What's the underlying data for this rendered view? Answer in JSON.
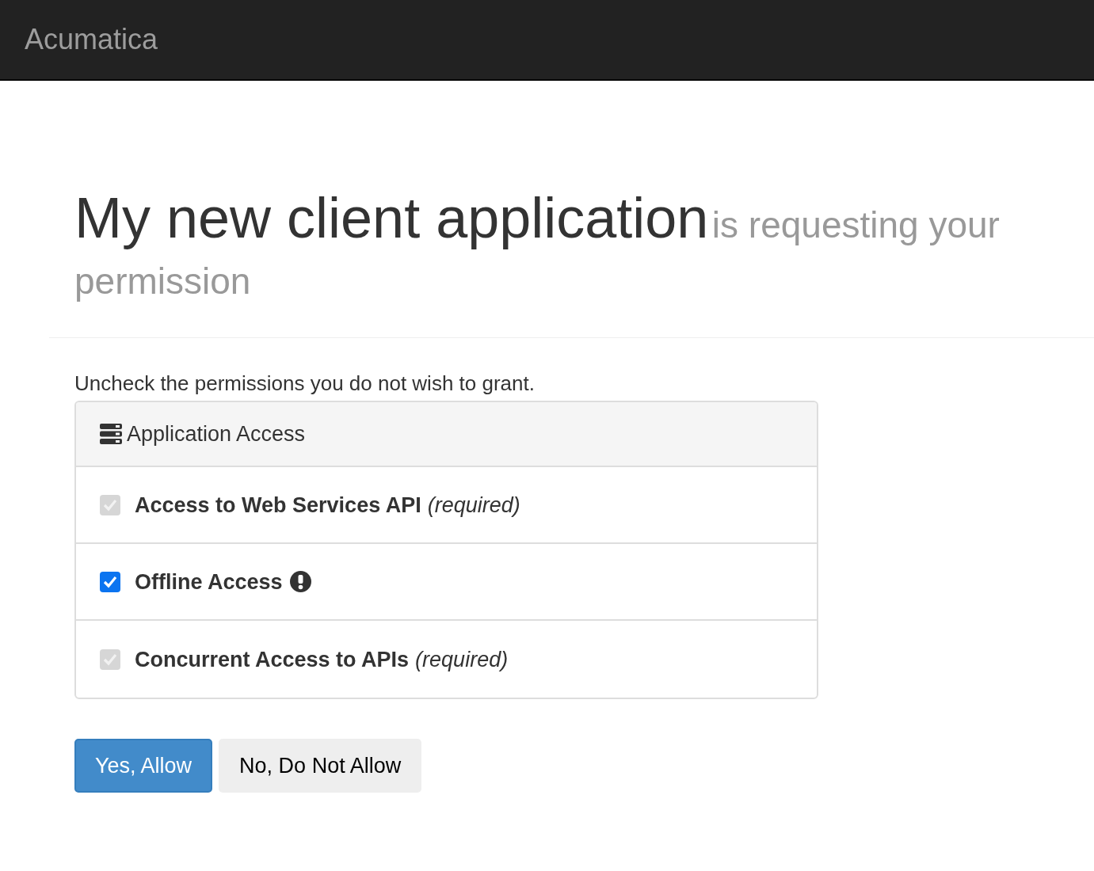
{
  "navbar": {
    "brand": "Acumatica"
  },
  "heading": {
    "title": "My new client application",
    "subtitle": "is requesting your permission"
  },
  "instruction": "Uncheck the permissions you do not wish to grant.",
  "panel": {
    "title": "Application Access",
    "permissions": [
      {
        "label": "Access to Web Services API",
        "note": "(required)",
        "checked": true,
        "disabled": true,
        "warning": false
      },
      {
        "label": "Offline Access",
        "checked": true,
        "disabled": false,
        "warning": true
      },
      {
        "label": "Concurrent Access to APIs",
        "note": "(required)",
        "checked": true,
        "disabled": true,
        "warning": false
      }
    ]
  },
  "buttons": [
    {
      "label": "Yes, Allow",
      "kind": "primary"
    },
    {
      "label": "No, Do Not Allow",
      "kind": "default"
    }
  ]
}
